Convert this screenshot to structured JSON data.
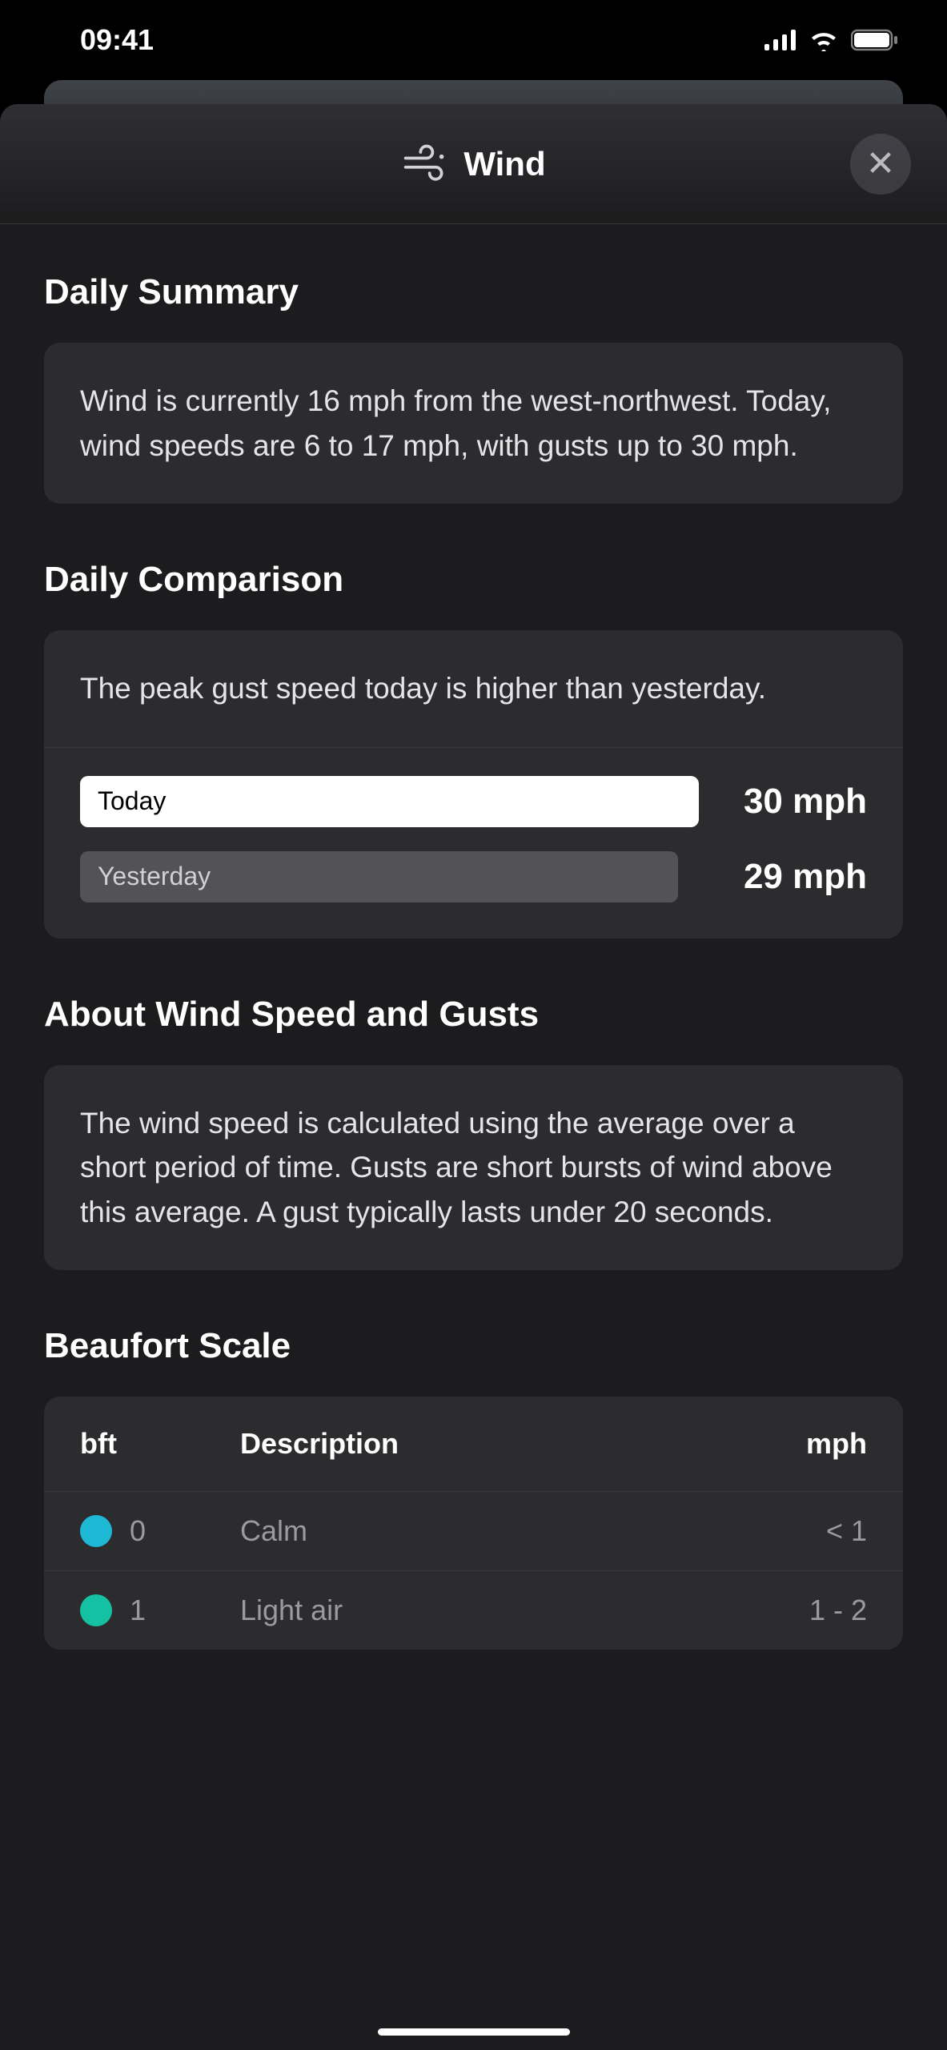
{
  "status": {
    "time": "09:41"
  },
  "header": {
    "title": "Wind"
  },
  "daily_summary": {
    "title": "Daily Summary",
    "text": "Wind is currently 16 mph from the west-northwest. Today, wind speeds are 6 to 17 mph, with gusts up to 30 mph."
  },
  "daily_comparison": {
    "title": "Daily Comparison",
    "text": "The peak gust speed today is higher than yesterday.",
    "rows": [
      {
        "label": "Today",
        "value": "30 mph",
        "percent": 100
      },
      {
        "label": "Yesterday",
        "value": "29 mph",
        "percent": 96.7
      }
    ]
  },
  "about": {
    "title": "About Wind Speed and Gusts",
    "text": "The wind speed is calculated using the average over a short period of time. Gusts are short bursts of wind above this average. A gust typically lasts under 20 seconds."
  },
  "beaufort": {
    "title": "Beaufort Scale",
    "headers": {
      "bft": "bft",
      "desc": "Description",
      "mph": "mph"
    },
    "rows": [
      {
        "color": "#1fb8d4",
        "bft": "0",
        "desc": "Calm",
        "mph": "< 1"
      },
      {
        "color": "#14c2a3",
        "bft": "1",
        "desc": "Light air",
        "mph": "1 - 2"
      }
    ]
  },
  "chart_data": {
    "type": "bar",
    "title": "Daily Comparison — Peak Gust Speed",
    "categories": [
      "Today",
      "Yesterday"
    ],
    "values": [
      30,
      29
    ],
    "ylabel": "mph",
    "ylim": [
      0,
      30
    ]
  }
}
